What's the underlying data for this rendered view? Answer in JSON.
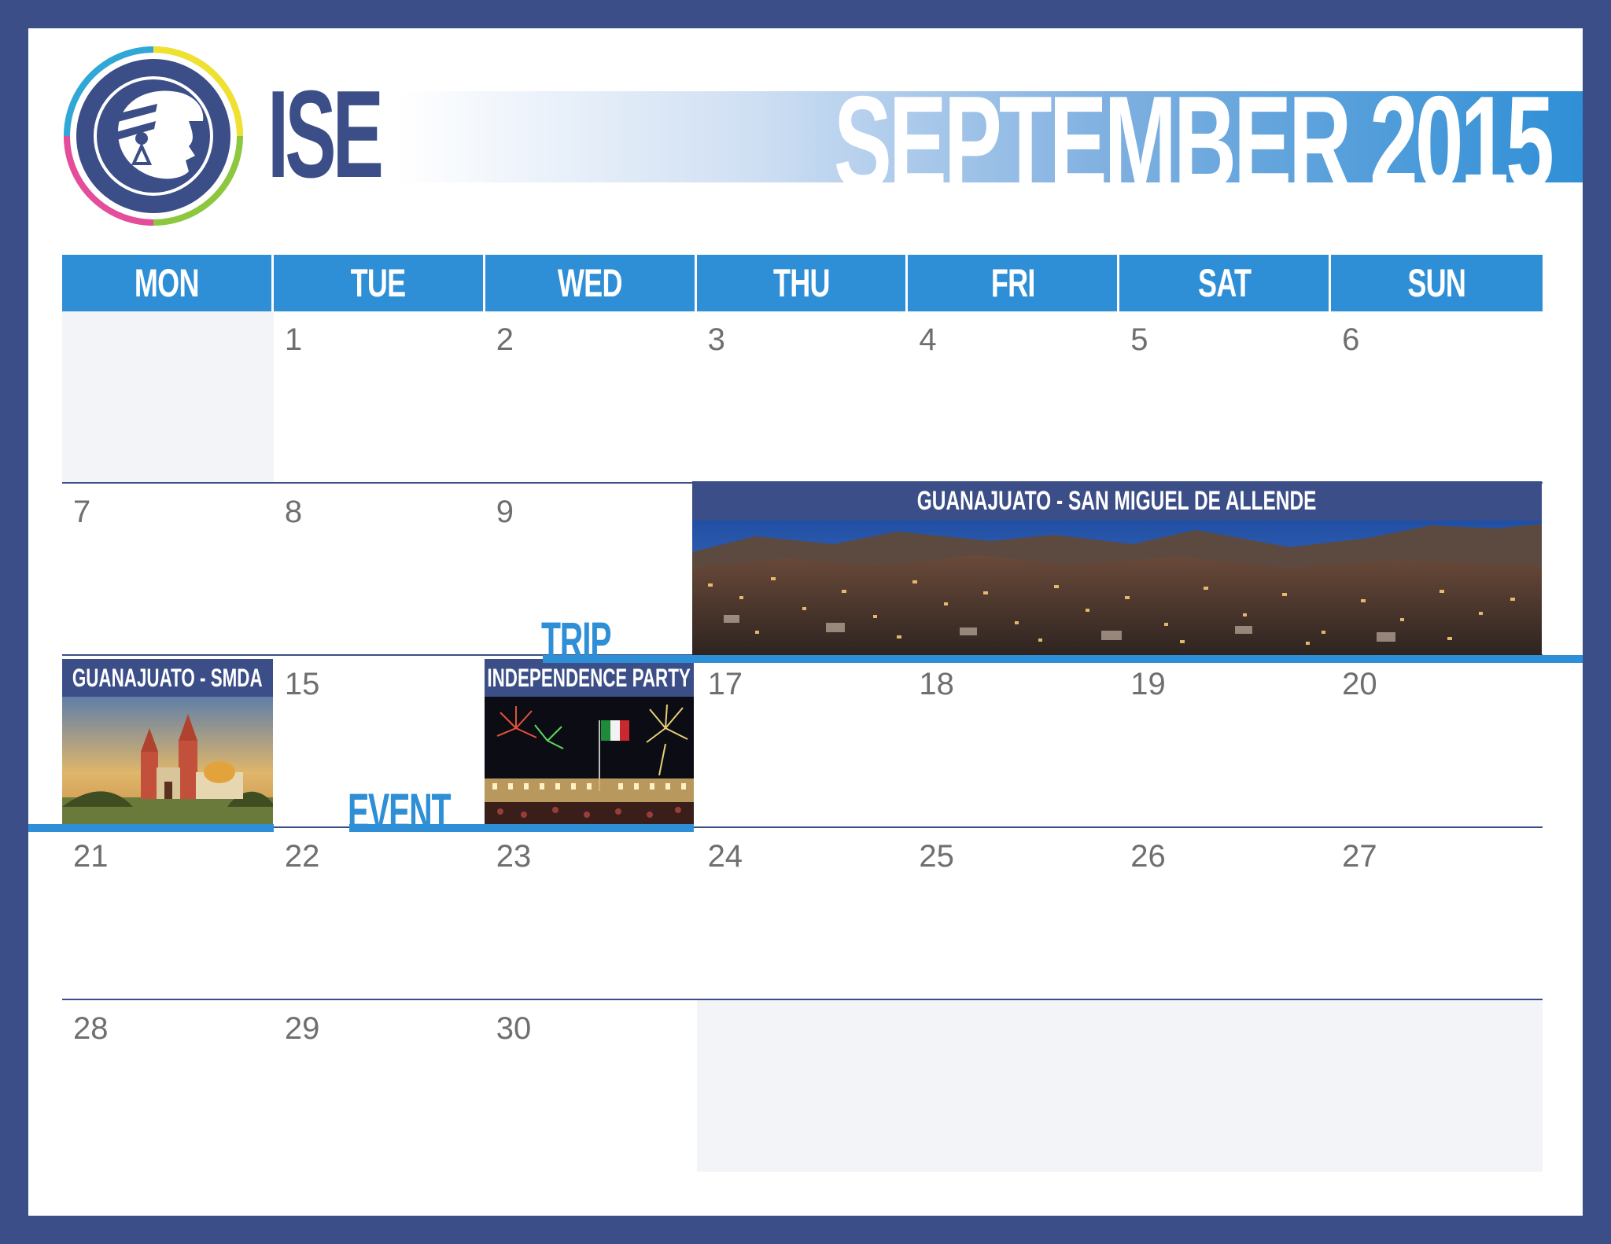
{
  "header": {
    "brand": "ISE",
    "title": "SEPTEMBER 2015"
  },
  "weekdays": [
    "MON",
    "TUE",
    "WED",
    "THU",
    "FRI",
    "SAT",
    "SUN"
  ],
  "weeks": [
    [
      "",
      "1",
      "2",
      "3",
      "4",
      "5",
      "6"
    ],
    [
      "7",
      "8",
      "9",
      "",
      "",
      "",
      ""
    ],
    [
      "",
      "15",
      "",
      "17",
      "18",
      "19",
      "20"
    ],
    [
      "21",
      "22",
      "23",
      "24",
      "25",
      "26",
      "27"
    ],
    [
      "28",
      "29",
      "30",
      "",
      "",
      "",
      ""
    ]
  ],
  "events": {
    "trip_banner": "GUANAJUATO - SAN MIGUEL DE ALLENDE",
    "trip_short": "GUANAJUATO - SMDA",
    "party": "INDEPENDENCE PARTY"
  },
  "categories": {
    "trip": "TRIP",
    "event": "EVENT"
  },
  "colors": {
    "frame": "#3b4e87",
    "accent": "#2f8fd6",
    "empty_cell": "#f3f4f7",
    "day_number": "#6f6f6f"
  },
  "icons": {
    "logo": "helmeted-head-logo-icon"
  }
}
